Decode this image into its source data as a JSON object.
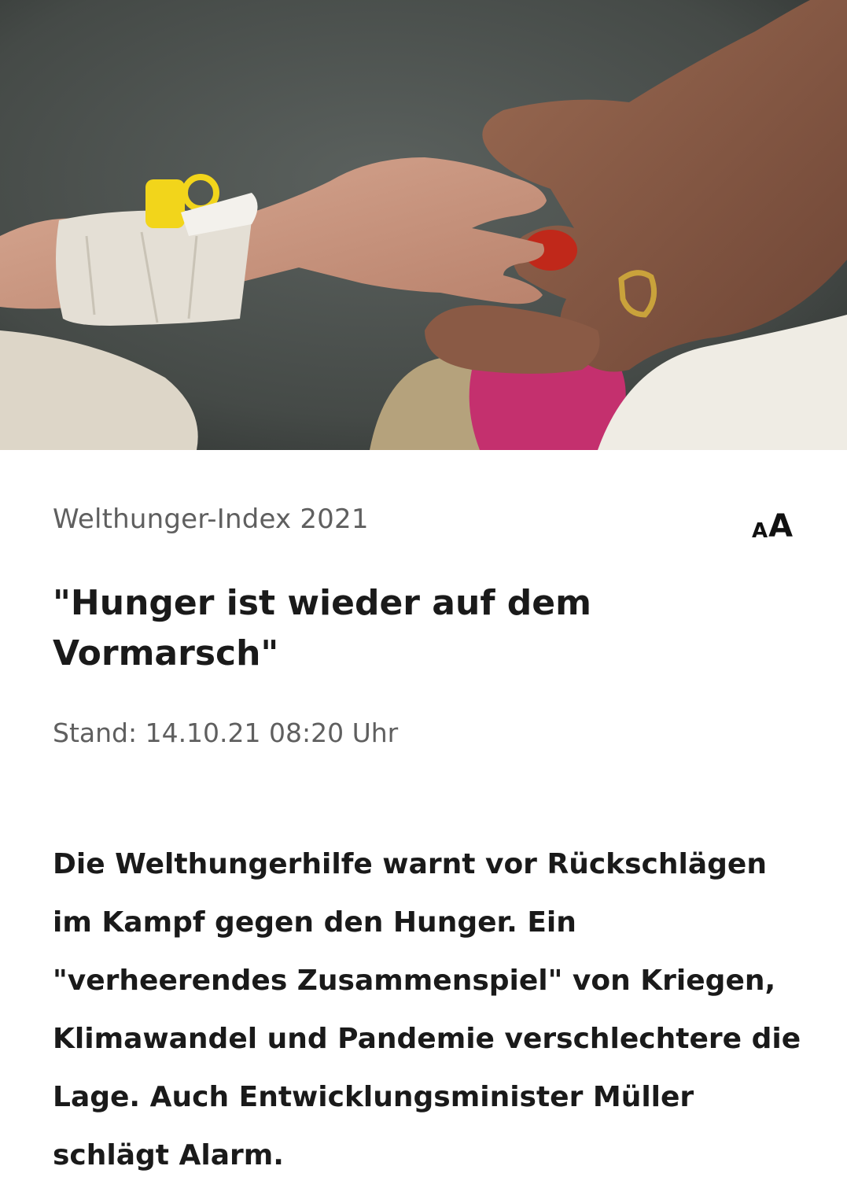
{
  "hero_image": {
    "alt": "",
    "icon": "photo-infant-hand-icon"
  },
  "article": {
    "topline": "Welthunger-Index 2021",
    "headline": "\"Hunger ist wieder auf dem Vormarsch\"",
    "dateline": "Stand: 14.10.21 08:20 Uhr",
    "teaser": "Die Welthungerhilfe warnt vor Rückschlägen im Kampf gegen den Hunger. Ein \"verheerendes Zusammenspiel\" von Kriegen, Klimawandel und Pandemie verschlechtere die Lage. Auch Entwicklungsminister Müller schlägt Alarm."
  },
  "font_size_control": {
    "small_label": "A",
    "large_label": "A",
    "icon": "font-size-icon"
  },
  "colors": {
    "text_primary": "#1a1a1a",
    "text_secondary": "#5f5f5f",
    "background": "#ffffff"
  }
}
